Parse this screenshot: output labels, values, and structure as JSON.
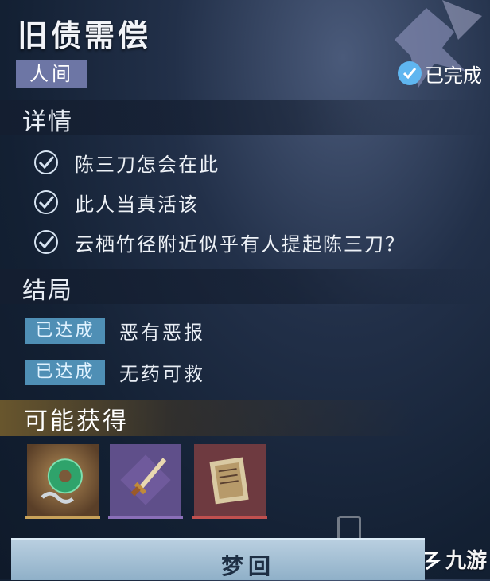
{
  "quest": {
    "title": "旧债需偿",
    "tag": "人间",
    "status": "已完成"
  },
  "details": {
    "heading": "详情",
    "tasks": [
      {
        "text": "陈三刀怎会在此",
        "checked": true
      },
      {
        "text": "此人当真活该",
        "checked": true
      },
      {
        "text": "云栖竹径附近似乎有人提起陈三刀？",
        "checked": true
      }
    ]
  },
  "endings": {
    "heading": "结局",
    "items": [
      {
        "badge": "已达成",
        "text": "恶有恶报"
      },
      {
        "badge": "已达成",
        "text": "无药可救"
      }
    ]
  },
  "rewards": {
    "heading": "可能获得",
    "items": [
      {
        "icon": "jade-pendant-icon",
        "rarity_color": "#c9a25a"
      },
      {
        "icon": "dagger-icon",
        "rarity_color": "#8a6fb8"
      },
      {
        "icon": "scroll-book-icon",
        "rarity_color": "#c0504f"
      }
    ]
  },
  "action": {
    "dream_label": "梦回"
  },
  "watermark": {
    "text": "九游"
  },
  "colors": {
    "tag_bg": "#6d76a5",
    "badge_bg": "#4f8fb5",
    "check_color": "#5fb6f0"
  }
}
